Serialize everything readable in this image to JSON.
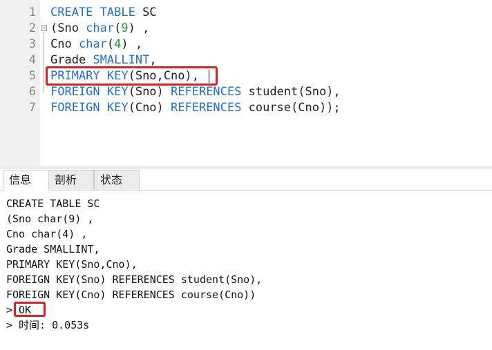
{
  "editor": {
    "lines": [
      {
        "no": "1",
        "tokens": [
          {
            "t": "CREATE TABLE ",
            "c": "kw"
          },
          {
            "t": "SC",
            "c": "plain"
          }
        ]
      },
      {
        "no": "2",
        "tokens": [
          {
            "t": "(Sno ",
            "c": "plain"
          },
          {
            "t": "char",
            "c": "kw"
          },
          {
            "t": "(",
            "c": "plain"
          },
          {
            "t": "9",
            "c": "num"
          },
          {
            "t": ") ,",
            "c": "plain"
          }
        ]
      },
      {
        "no": "3",
        "tokens": [
          {
            "t": "Cno ",
            "c": "plain"
          },
          {
            "t": "char",
            "c": "kw"
          },
          {
            "t": "(",
            "c": "plain"
          },
          {
            "t": "4",
            "c": "num"
          },
          {
            "t": ") ,",
            "c": "plain"
          }
        ]
      },
      {
        "no": "4",
        "tokens": [
          {
            "t": "Grade ",
            "c": "plain"
          },
          {
            "t": "SMALLINT",
            "c": "kw"
          },
          {
            "t": ",",
            "c": "plain"
          }
        ]
      },
      {
        "no": "5",
        "tokens": [
          {
            "t": "PRIMARY KEY",
            "c": "kw"
          },
          {
            "t": "(Sno,Cno),",
            "c": "plain"
          }
        ]
      },
      {
        "no": "6",
        "tokens": [
          {
            "t": "FOREIGN KEY",
            "c": "kw"
          },
          {
            "t": "(Sno) ",
            "c": "plain"
          },
          {
            "t": "REFERENCES",
            "c": "kw"
          },
          {
            "t": " student(Sno),",
            "c": "plain"
          }
        ]
      },
      {
        "no": "7",
        "tokens": [
          {
            "t": "FOREIGN KEY",
            "c": "kw"
          },
          {
            "t": "(Cno) ",
            "c": "plain"
          },
          {
            "t": "REFERENCES",
            "c": "kw"
          },
          {
            "t": " course(Cno));",
            "c": "plain"
          }
        ]
      }
    ]
  },
  "tabs": [
    {
      "label": "信息",
      "active": true
    },
    {
      "label": "剖析",
      "active": false
    },
    {
      "label": "状态",
      "active": false
    }
  ],
  "output": {
    "lines": [
      "CREATE TABLE SC",
      "(Sno char(9) ,",
      "Cno char(4) ,",
      "Grade SMALLINT,",
      "PRIMARY KEY(Sno,Cno),",
      "FOREIGN KEY(Sno) REFERENCES student(Sno),",
      "FOREIGN KEY(Cno) REFERENCES course(Cno))",
      "> OK",
      "> 时间: 0.053s"
    ]
  },
  "colors": {
    "keyword": "#1f6fd6",
    "number": "#1a9a2a",
    "highlight": "#e02020"
  }
}
